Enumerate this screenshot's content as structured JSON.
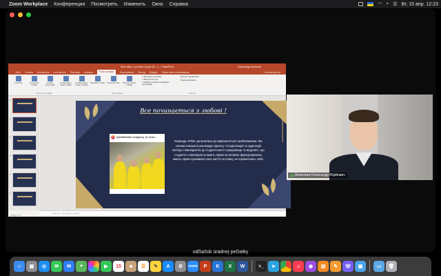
{
  "menubar": {
    "app": "Zoom Workplace",
    "items": [
      "Конференция",
      "Посмотреть",
      "Изменить",
      "Окно",
      "Справка"
    ],
    "clock": "Вт, 15 апр. 12:23"
  },
  "powerpoint": {
    "title": "Фото slide_1 (version 1).pptx (R...) — PowerPoint",
    "user": "Олександр Алексеєв",
    "tabs": [
      "Файл",
      "Головна",
      "Вставлення",
      "Конструктор",
      "Переходи",
      "Анімація",
      "Показ слайдів",
      "Рецензування",
      "Вигляд",
      "Довідка",
      "Оцінки свого розпізнавання"
    ],
    "active_tab": "Показ слайдів",
    "share_label": "Спільний доступ",
    "ribbon_buttons": [
      "З початку",
      "З поточного слайда",
      "Онлайн-презентація",
      "Налаштувати показ слайдів",
      "Налаштування показу слайдів",
      "Приховати слайд",
      "Репетиція часу",
      "Записати показ слайдів"
    ],
    "ribbon_checks": [
      "Відтворити розповіді",
      "Використати час",
      "Показати елементи керування мультимедіа"
    ],
    "monitor_label": "Монітор: Автоматично",
    "presenter_label": "Режим доповідача",
    "group_labels": [
      "Почати показ слайдів",
      "Налаштування",
      "Монітори"
    ],
    "notes_placeholder": "Натисніть, щоб додати нотатки",
    "status": "Слайд 1 з 15"
  },
  "slide": {
    "title": "Все починається з любові !",
    "instagram_handle": "ayshiftukraine та agency_of_local...",
    "body": "Команда «Pilot» долучилася до вирішення цієї проблематики. Ми хочемо показати реалізацію проекту «Соціалізація та адаптація молоді з інвалідністю до студентського середовища та ведучих», що студенти з інвалідністю мають право на активне функціонування, мають право проживати своє життя на повну, не соромлячись себе."
  },
  "participant": {
    "name": "Алексеев Олександр Юрійович"
  },
  "caption": "odčiačok úradnej pečiatky",
  "dock": {
    "apps": [
      "finder-icon",
      "launchpad-icon",
      "safari-icon",
      "messages-icon",
      "mail-icon",
      "maps-icon",
      "photos-icon",
      "facetime-icon",
      "calendar-icon",
      "contacts-icon",
      "reminders-icon",
      "notes-icon",
      "appstore-icon",
      "settings-icon",
      "zoom-icon",
      "powerpoint-icon",
      "keynote-icon",
      "excel-icon",
      "word-icon",
      "terminal-icon",
      "telegram-icon",
      "chrome-icon",
      "music-icon",
      "podcasts-icon",
      "books-icon",
      "pages-icon",
      "viber-icon",
      "preview-icon",
      "folder-icon",
      "trash-icon"
    ]
  }
}
